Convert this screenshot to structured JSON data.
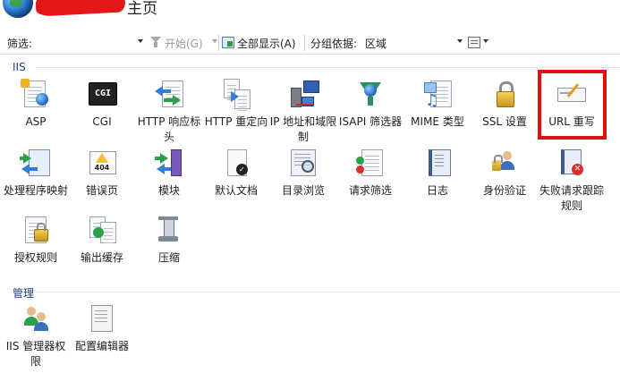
{
  "header": {
    "title_suffix": "主页",
    "redaction_color": "#e21818"
  },
  "toolbar": {
    "filter_label": "筛选:",
    "filter_value": "",
    "start_label": "开始(G)",
    "show_all_label": "全部显示(A)",
    "group_by_label": "分组依据:",
    "group_by_value": "区域"
  },
  "sections": {
    "iis": "IIS",
    "management": "管理"
  },
  "features": {
    "iis": [
      {
        "name": "asp",
        "label": "ASP",
        "icon": "asp-icon"
      },
      {
        "name": "cgi",
        "label": "CGI",
        "icon": "cgi-icon"
      },
      {
        "name": "http-response-headers",
        "label": "HTTP 响应标头",
        "icon": "http-response-headers-icon"
      },
      {
        "name": "http-redirect",
        "label": "HTTP 重定向",
        "icon": "http-redirect-icon"
      },
      {
        "name": "ip-domain-restrictions",
        "label": "IP 地址和域限制",
        "icon": "ip-domain-restrictions-icon"
      },
      {
        "name": "isapi-filters",
        "label": "ISAPI 筛选器",
        "icon": "isapi-filters-icon"
      },
      {
        "name": "mime-types",
        "label": "MIME 类型",
        "icon": "mime-types-icon"
      },
      {
        "name": "ssl-settings",
        "label": "SSL 设置",
        "icon": "ssl-lock-icon"
      },
      {
        "name": "url-rewrite",
        "label": "URL 重写",
        "icon": "url-rewrite-icon"
      },
      {
        "name": "handler-mappings",
        "label": "处理程序映射",
        "icon": "handler-mappings-icon"
      },
      {
        "name": "error-pages",
        "label": "错误页",
        "icon": "error-page-404-icon"
      },
      {
        "name": "modules",
        "label": "模块",
        "icon": "modules-icon"
      },
      {
        "name": "default-document",
        "label": "默认文档",
        "icon": "default-document-icon"
      },
      {
        "name": "directory-browsing",
        "label": "目录浏览",
        "icon": "directory-browsing-icon"
      },
      {
        "name": "request-filtering",
        "label": "请求筛选",
        "icon": "request-filtering-icon"
      },
      {
        "name": "logging",
        "label": "日志",
        "icon": "logging-icon"
      },
      {
        "name": "authentication",
        "label": "身份验证",
        "icon": "authentication-icon"
      },
      {
        "name": "failed-request-tracing",
        "label": "失败请求跟踪规则",
        "icon": "failed-request-tracing-icon"
      },
      {
        "name": "authorization-rules",
        "label": "授权规则",
        "icon": "authorization-rules-icon"
      },
      {
        "name": "output-caching",
        "label": "输出缓存",
        "icon": "output-caching-icon"
      },
      {
        "name": "compression",
        "label": "压缩",
        "icon": "compression-icon"
      }
    ],
    "management": [
      {
        "name": "iis-manager-permissions",
        "label": "IIS 管理器权限",
        "icon": "iis-manager-permissions-icon"
      },
      {
        "name": "configuration-editor",
        "label": "配置编辑器",
        "icon": "configuration-editor-icon"
      }
    ]
  },
  "highlight_color": "#e01010"
}
